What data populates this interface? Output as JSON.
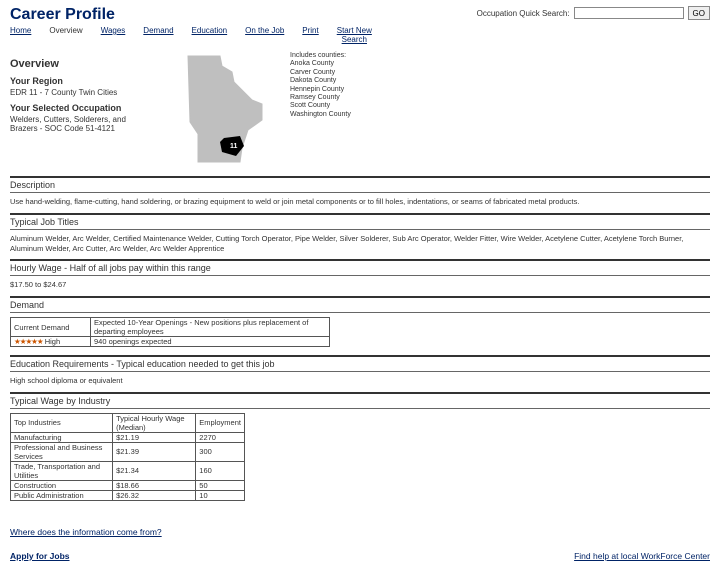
{
  "header": {
    "title": "Career Profile",
    "quick_search_label": "Occupation Quick Search:",
    "go_label": "GO"
  },
  "nav": {
    "home": "Home",
    "overview": "Overview",
    "wages": "Wages",
    "demand": "Demand",
    "education": "Education",
    "on_the_job": "On the Job",
    "print": "Print",
    "start_new": "Start New\nSearch"
  },
  "overview": {
    "heading": "Overview",
    "region_label": "Your Region",
    "region_value": "EDR 11 - 7 County Twin Cities",
    "occupation_label": "Your Selected Occupation",
    "occupation_value": "Welders, Cutters, Solderers, and Brazers - SOC Code 51-4121"
  },
  "counties": {
    "header": "Includes counties:",
    "list": [
      "Anoka County",
      "Carver County",
      "Dakota County",
      "Hennepin County",
      "Ramsey County",
      "Scott County",
      "Washington County"
    ]
  },
  "description": {
    "heading": "Description",
    "text": "Use hand-welding, flame-cutting, hand soldering, or brazing equipment to weld or join metal components or to fill holes, indentations, or seams of fabricated metal products."
  },
  "titles": {
    "heading": "Typical Job Titles",
    "text": "Aluminum Welder, Arc Welder, Certified Maintenance Welder, Cutting Torch Operator, Pipe Welder, Silver Solderer, Sub Arc Operator, Welder Fitter, Wire Welder, Acetylene Cutter, Acetylene Torch Burner, Aluminum Welder, Arc Cutter, Arc Welder, Arc Welder Apprentice"
  },
  "hourly_wage": {
    "heading": "Hourly Wage - Half of all jobs pay within this range",
    "text": "$17.50 to $24.67"
  },
  "demand": {
    "heading": "Demand",
    "row1_label": "Current Demand",
    "row1_value": "Expected 10-Year Openings - New positions plus replacement of departing employees",
    "row2_stars": "★★★★★",
    "row2_label": " High",
    "row2_value": "940 openings expected"
  },
  "education": {
    "heading": "Education Requirements - Typical education needed to get this job",
    "text": "High school diploma or equivalent"
  },
  "wage_industry": {
    "heading": "Typical Wage by Industry",
    "cols": [
      "Top Industries",
      "Typical Hourly Wage (Median)",
      "Employment"
    ],
    "rows": [
      [
        "Manufacturing",
        "$21.19",
        "2270"
      ],
      [
        "Professional and Business Services",
        "$21.39",
        "300"
      ],
      [
        "Trade, Transportation and Utilities",
        "$21.34",
        "160"
      ],
      [
        "Construction",
        "$18.66",
        "50"
      ],
      [
        "Public Administration",
        "$26.32",
        "10"
      ]
    ]
  },
  "links": {
    "info_source": "Where does the information come from?",
    "apply": "Apply for Jobs",
    "find_help": "Find help at local WorkForce Center"
  }
}
